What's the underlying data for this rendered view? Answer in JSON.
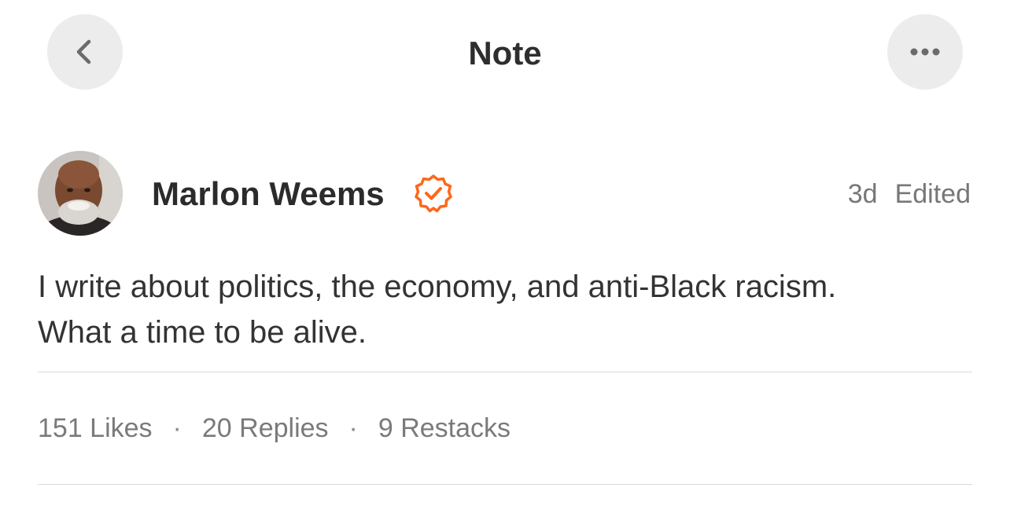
{
  "header": {
    "title": "Note",
    "back_icon": "chevron-left-icon",
    "more_icon": "more-horizontal-icon"
  },
  "author": {
    "name": "Marlon Weems",
    "verified_icon": "verified-badge-icon",
    "verified_color": "#ff6719"
  },
  "meta": {
    "time": "3d",
    "edited": "Edited"
  },
  "note": {
    "line1": "I write about politics, the economy, and anti-Black racism.",
    "line2": "What a time to be alive."
  },
  "stats": {
    "likes": "151 Likes",
    "replies": "20 Replies",
    "restacks": "9 Restacks",
    "separator": "·"
  }
}
